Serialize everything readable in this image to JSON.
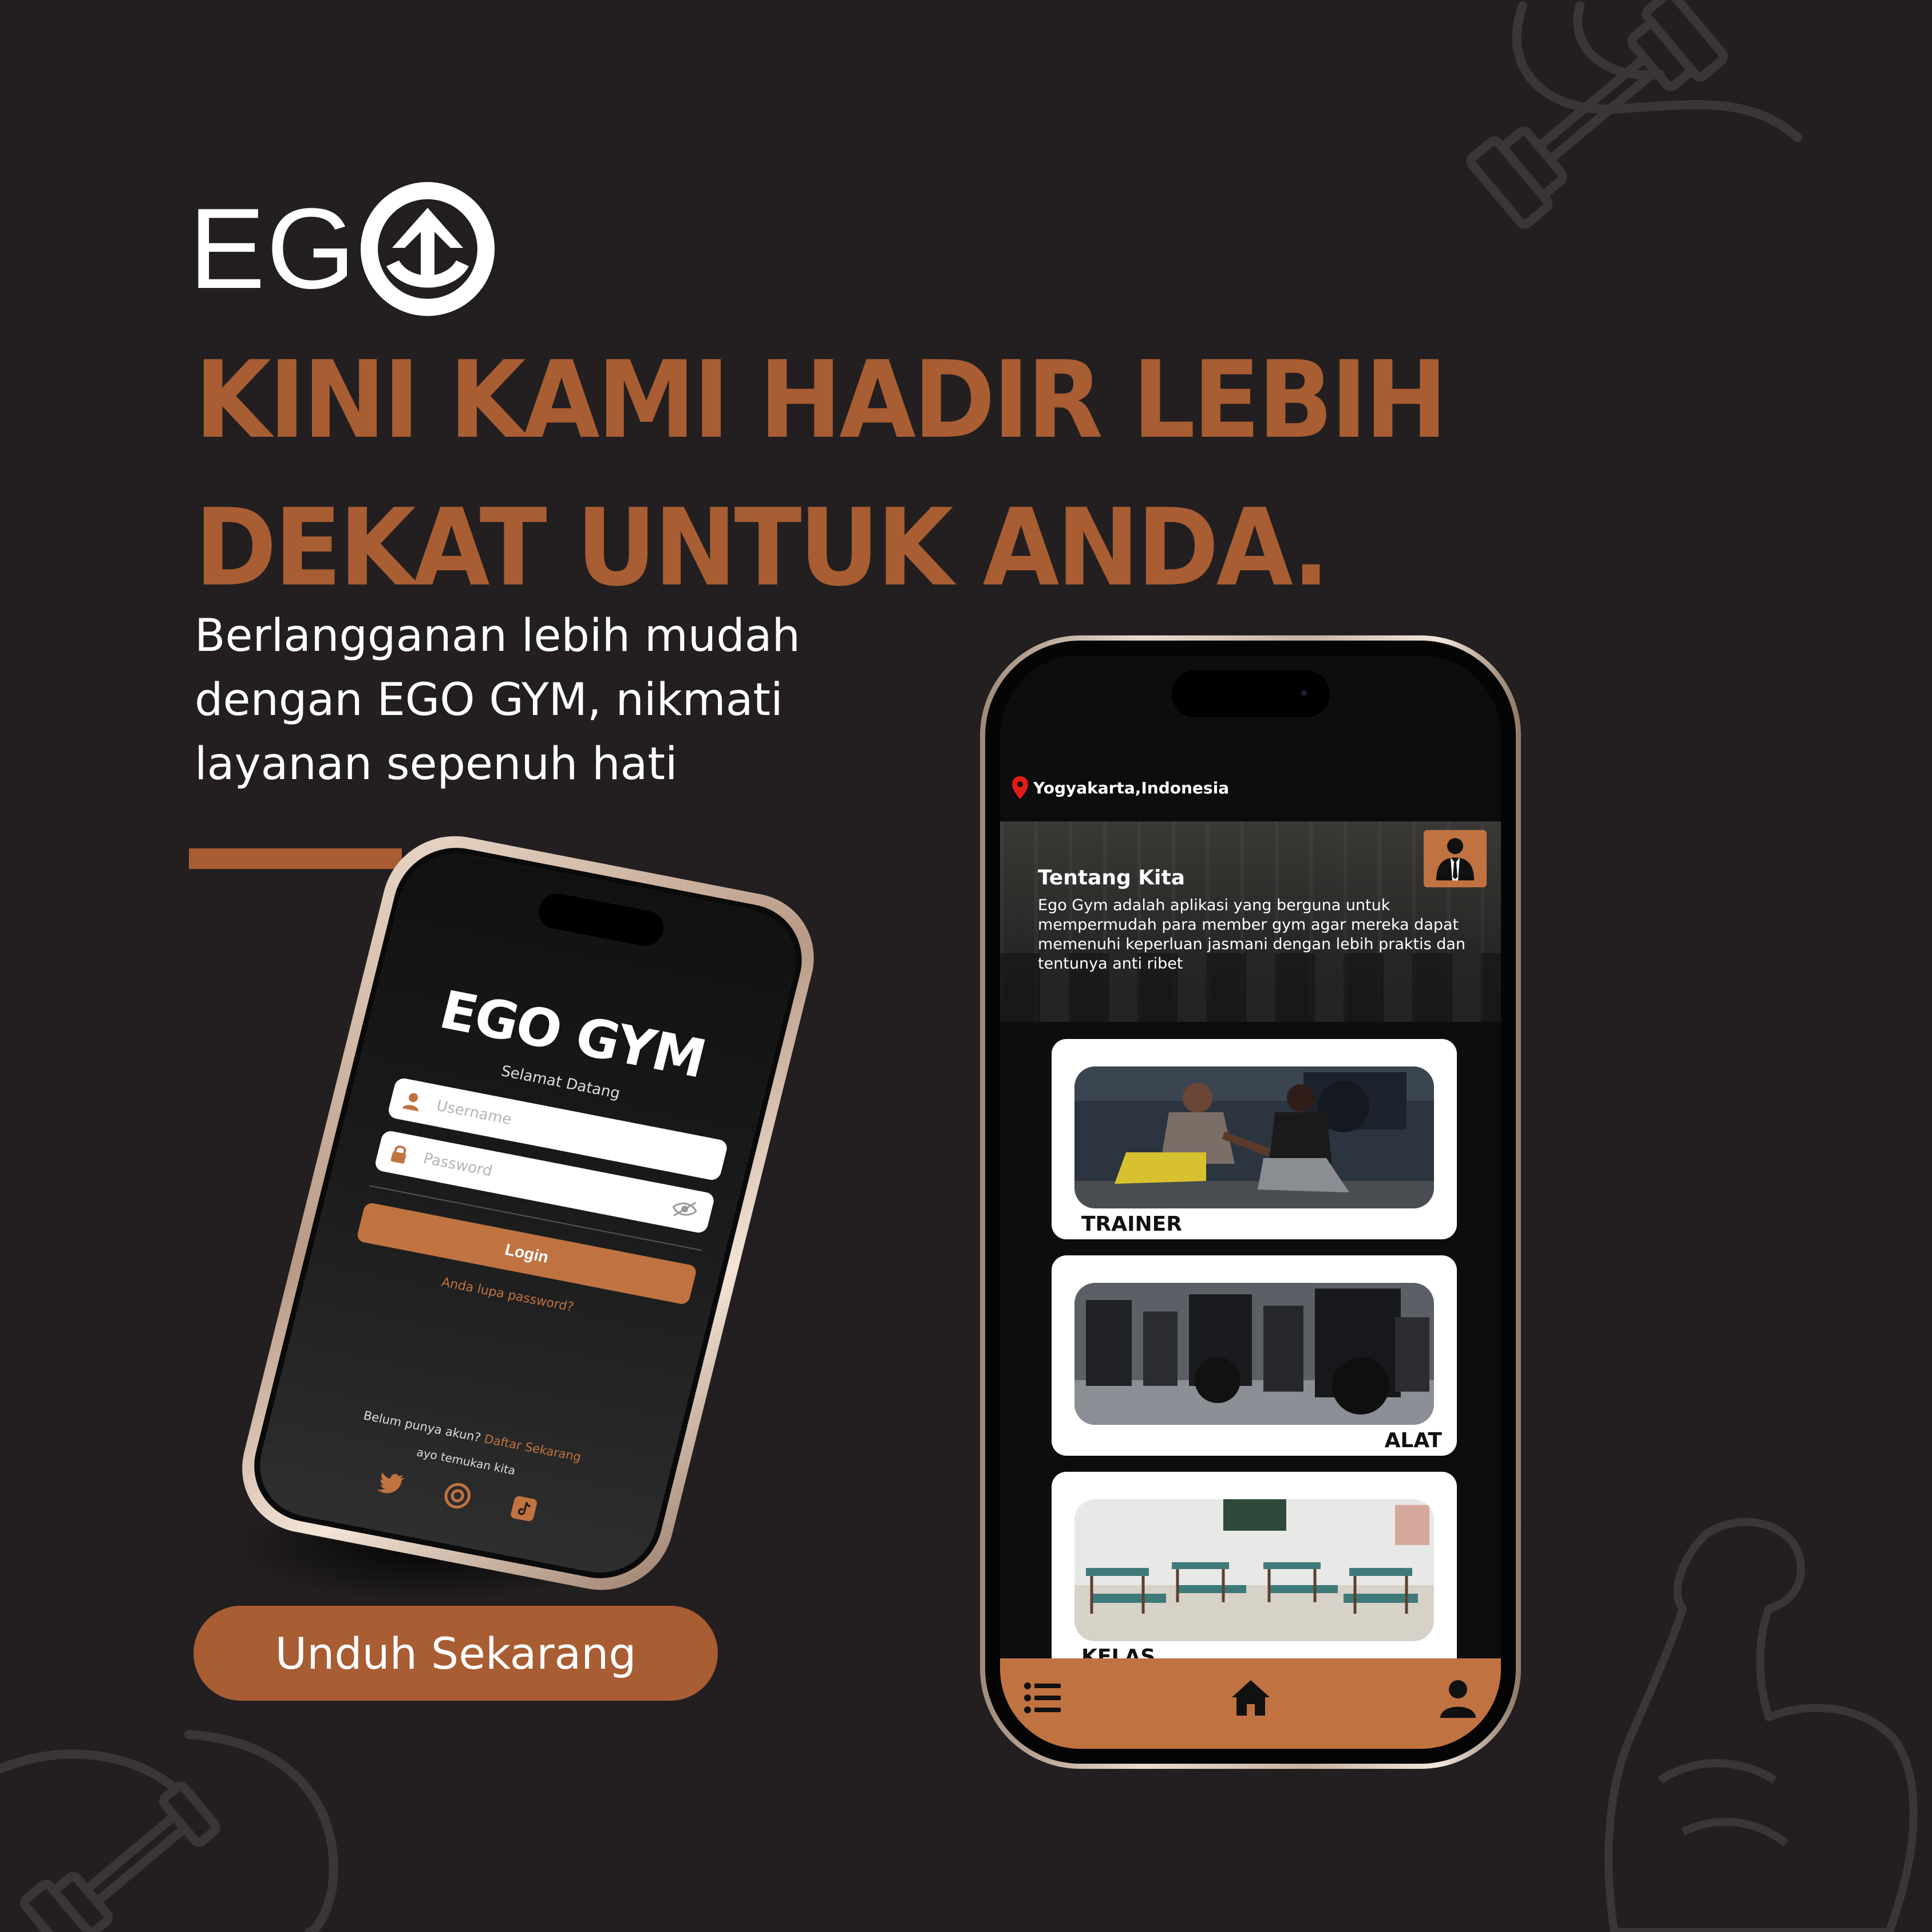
{
  "brand": {
    "logo_text": "EG",
    "colors": {
      "background": "#231f20",
      "accent": "#a85d33",
      "app_accent": "#c07341",
      "text": "#ffffff"
    }
  },
  "headline": {
    "line1": "KINI KAMI HADIR LEBIH",
    "line2": "DEKAT UNTUK ANDA."
  },
  "subtext": {
    "line1": "Berlangganan lebih mudah",
    "line2": "dengan EGO GYM, nikmati",
    "line3": "layanan sepenuh hati"
  },
  "cta": {
    "label": "Unduh Sekarang"
  },
  "login_screen": {
    "title": "EGO GYM",
    "subtitle": "Selamat Datang",
    "username_placeholder": "Username",
    "password_placeholder": "Password",
    "login_button": "Login",
    "forgot_password": "Anda lupa password?",
    "register_prompt": "Belum punya akun?",
    "register_link": "Daftar Sekarang",
    "find_us": "ayo temukan kita",
    "socials": [
      "twitter-icon",
      "instagram-icon",
      "tiktok-icon"
    ]
  },
  "home_screen": {
    "location": "Yogyakarta,Indonesia",
    "about": {
      "title": "Tentang Kita",
      "body": "Ego Gym adalah aplikasi yang berguna untuk mempermudah para member gym agar mereka dapat memenuhi keperluan jasmani dengan lebih praktis dan tentunya anti ribet"
    },
    "cards": [
      {
        "label": "TRAINER"
      },
      {
        "label": "ALAT"
      },
      {
        "label": "KELAS"
      }
    ],
    "nav": [
      "menu-list-icon",
      "home-icon",
      "profile-icon"
    ]
  }
}
